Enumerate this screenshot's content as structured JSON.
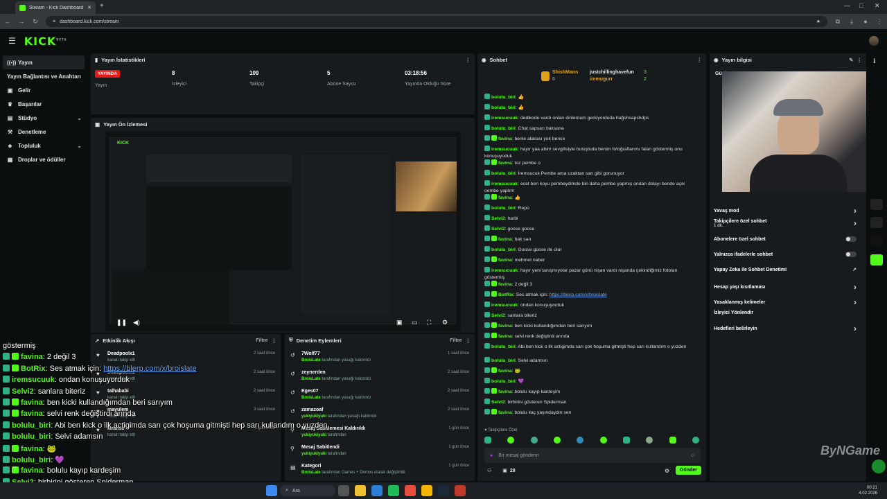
{
  "browser": {
    "tab_title": "Stream - Kick Dashboard",
    "url": "dashboard.kick.com/stream"
  },
  "header": {
    "logo": "KICK",
    "logo_sup": "BETA"
  },
  "sidebar": {
    "items": [
      {
        "label": "Yayın",
        "icon": "broadcast-icon"
      },
      {
        "label": "Yayın Bağlantısı ve Anahtarı",
        "icon": "key-icon"
      },
      {
        "label": "Gelir",
        "icon": "money-icon"
      },
      {
        "label": "Başarılar",
        "icon": "trophy-icon"
      },
      {
        "label": "Stüdyo",
        "icon": "studio-icon"
      },
      {
        "label": "Denetleme",
        "icon": "wrench-icon"
      },
      {
        "label": "Topluluk",
        "icon": "community-icon"
      },
      {
        "label": "Droplar ve ödüller",
        "icon": "gift-icon"
      }
    ]
  },
  "stats": {
    "title": "Yayın İstatistikleri",
    "live_badge": "YAYINDA",
    "live_label": "Yayın",
    "viewers": "8",
    "viewers_label": "İzleyici",
    "followers": "109",
    "followers_label": "Takipçi",
    "subs": "5",
    "subs_label": "Abone Sayısı",
    "uptime": "03:18:56",
    "uptime_label": "Yayında Olduğu Süre"
  },
  "preview": {
    "title": "Yayın Ön İzlemesi",
    "watermark": "ByNGame"
  },
  "activity": {
    "title": "Etkinlik Akışı",
    "filter": "Filtre",
    "items": [
      {
        "name": "Deadpoolx1",
        "sub": "kanalı takip etti",
        "time": "2 saat önce"
      },
      {
        "name": "Deadpoolx1",
        "sub": "kanalı takip etti",
        "time": "2 saat önce"
      },
      {
        "name": "talhababi",
        "sub": "kanalı takip etti",
        "time": "2 saat önce"
      },
      {
        "name": "mayulem",
        "sub": "kanalı takip etti",
        "time": "3 saat önce"
      },
      {
        "name": "kiraiiso",
        "sub": "kanalı takip etti",
        "time": "1 gün önce"
      }
    ]
  },
  "moderation": {
    "title": "Denetim Eylemleri",
    "filter": "Filtre",
    "items": [
      {
        "name": "7Wolf77",
        "actor": "BroisLate",
        "sub": "tarafından yasağı kaldırıldı",
        "time": "1 saat önce"
      },
      {
        "name": "zeynerden",
        "actor": "BroisLate",
        "sub": "tarafından yasağı kaldırıldı",
        "time": "2 saat önce"
      },
      {
        "name": "Eges07",
        "actor": "BroisLate",
        "sub": "tarafından yasağı kaldırıldı",
        "time": "2 saat önce"
      },
      {
        "name": "zamazoaf",
        "actor": "yukiyukiyuki",
        "sub": "tarafından yasağı kaldırıldı",
        "time": "2 saat önce"
      },
      {
        "name": "Mesaj Sabitlemesi Kaldırıldı",
        "actor": "yukiyukiyuki",
        "sub": "tarafından",
        "time": "1 gün önce"
      },
      {
        "name": "Mesaj Sabitlendi",
        "actor": "yukiyukiyuki",
        "sub": "tarafından",
        "time": "1 gün önce"
      },
      {
        "name": "Kategori",
        "actor": "BroisLate",
        "sub": "tarafından Games + Demos olarak değiştirildi",
        "time": "1 gün önce"
      }
    ]
  },
  "chat": {
    "title": "Sohbet",
    "top": [
      {
        "name": "ShishMann",
        "count": "6"
      },
      {
        "name": "justchillinghavefun",
        "count": "3"
      },
      {
        "name": "iremugurr",
        "count": "2"
      }
    ],
    "messages": [
      {
        "user": "bolulu_biri",
        "color": "#53fc18",
        "text": "👍"
      },
      {
        "user": "bolulu_biri",
        "color": "#53fc18",
        "text": "👍"
      },
      {
        "user": "iremsucuuk",
        "color": "#53fc18",
        "text": "dedikodu vardı onları dinlemem gerkiyorduda hağshsapshdps"
      },
      {
        "user": "bolulu_biri",
        "color": "#53fc18",
        "text": "Chat sapsarı baksana"
      },
      {
        "user": "favina",
        "color": "#53fc18",
        "text": "benle alakası yok bence"
      },
      {
        "user": "iremsucuuk",
        "color": "#53fc18",
        "text": "hayır yaa abim sevgilisiyle buluştuda benim fotoğraflarımı falan göstermiş onu konuşuyoduk"
      },
      {
        "user": "favina",
        "color": "#53fc18",
        "text": "toz pembe o"
      },
      {
        "user": "bolulu_biri",
        "color": "#53fc18",
        "text": "İremsucuk Pembe ama uzaktan san gibi gorunuyor"
      },
      {
        "user": "iremsucuuk",
        "color": "#53fc18",
        "text": "ecet ben koyu pembeydimde biri daha pembe yapmış ondan dolayı bende açık oembe yaptım"
      },
      {
        "user": "favina",
        "color": "#53fc18",
        "text": "👍"
      },
      {
        "user": "bolulu_biri",
        "color": "#53fc18",
        "text": "Repo"
      },
      {
        "user": "Selvi2",
        "color": "#53fc18",
        "text": "harbi"
      },
      {
        "user": "Selvi2",
        "color": "#53fc18",
        "text": "goose goose"
      },
      {
        "user": "favina",
        "color": "#53fc18",
        "text": "bak sarı"
      },
      {
        "user": "bolulu_biri",
        "color": "#53fc18",
        "text": "Goose goose de olur"
      },
      {
        "user": "favina",
        "color": "#53fc18",
        "text": "mehmet naber"
      },
      {
        "user": "iremsucuuk",
        "color": "#53fc18",
        "text": "hayır yeni tanışmıyolar pazar günü nişan vardı nişanda çekindiğimiz fotoları göstermiş"
      },
      {
        "user": "favina",
        "color": "#53fc18",
        "text": "2 değil 3"
      },
      {
        "user": "BotRix",
        "color": "#53fc18",
        "text": "Ses atmak için: ",
        "link": "https://blerp.com/x/broislate"
      },
      {
        "user": "iremsucuuk",
        "color": "#53fc18",
        "text": "ondan konuşuyorduk"
      },
      {
        "user": "Selvi2",
        "color": "#53fc18",
        "text": "sanlara biteriz"
      },
      {
        "user": "favina",
        "color": "#53fc18",
        "text": "ben kicki kullandığımdan beri sarıyım"
      },
      {
        "user": "favina",
        "color": "#53fc18",
        "text": "selvi renk değiştirdi arında"
      },
      {
        "user": "bolulu_biri",
        "color": "#53fc18",
        "text": "Abi ben kick o ilk actigimda sarı çok hoşuma gitmişti hep sarı kullandım o yuzden"
      },
      {
        "user": "bolulu_biri",
        "color": "#53fc18",
        "text": "Selvi adamsın"
      },
      {
        "user": "favina",
        "color": "#53fc18",
        "text": "🐸"
      },
      {
        "user": "bolulu_biri",
        "color": "#53fc18",
        "text": "💜"
      },
      {
        "user": "favina",
        "color": "#53fc18",
        "text": "bolulu kayıp kardeşim"
      },
      {
        "user": "Selvi2",
        "color": "#53fc18",
        "text": "birbirini gösteren Spiderman"
      },
      {
        "user": "favina",
        "color": "#53fc18",
        "text": "bolulu kaç yaşındaydın sen"
      }
    ],
    "followers_only": "Takipçilere Özel",
    "input_placeholder": "Bir mesaj gönderin",
    "viewer_count": "28",
    "send": "Gönder"
  },
  "stream_info": {
    "title": "Yayın bilgisi",
    "panel_label": "Günl",
    "rows": [
      {
        "label": "Yavaş mod",
        "end": "chevron"
      },
      {
        "label": "Takipçilere özel sohbet",
        "sub": "1 dk.",
        "end": "chevron"
      },
      {
        "label": "Abonelere özel sohbet",
        "end": "toggle"
      },
      {
        "label": "Yalnızca ifadelerle sohbet",
        "end": "toggle"
      },
      {
        "label": "Yapay Zeka ile Sohbet Denetimi",
        "end": "external"
      },
      {
        "label": "Hesap yaşı kısıtlaması",
        "end": "chevron"
      },
      {
        "label": "Yasaklanmış kelimeler",
        "end": "chevron"
      },
      {
        "label": "İzleyici Yönlendir",
        "end": ""
      },
      {
        "label": "Hedefleri belirleyin",
        "end": "chevron"
      }
    ]
  },
  "overlay_chat": [
    {
      "user": "",
      "text": "göstermiş"
    },
    {
      "user": "favina",
      "text": ": 2 değil 3"
    },
    {
      "user": "BotRix",
      "text": ": Ses atmak için: ",
      "link": "https://blerp.com/x/broislate"
    },
    {
      "user": "iremsucuuk",
      "text": ": ondan konuşuyorduk"
    },
    {
      "user": "Selvi2",
      "text": ": sanlara biteriz"
    },
    {
      "user": "favina",
      "text": ": ben kicki kullandığımdan beri sarıyım"
    },
    {
      "user": "favina",
      "text": ": selvi renk değiştirdi arında"
    },
    {
      "user": "bolulu_biri",
      "text": ": Abi ben kick o ilk actigimda sarı çok hoşuma gitmişti hep sarı kullandım o yuzden"
    },
    {
      "user": "bolulu_biri",
      "text": ": Selvi adamsın"
    },
    {
      "user": "favina",
      "text": ": 🐸"
    },
    {
      "user": "bolulu_biri",
      "text": ": 💜"
    },
    {
      "user": "favina",
      "text": ": bolulu kayıp kardeşim"
    },
    {
      "user": "Selvi2",
      "text": ": birbirini gösteren Spiderman"
    },
    {
      "user": "favina",
      "text": ": bolulu kaç yaşındaydın sen"
    }
  ],
  "taskbar": {
    "search": "Ara",
    "time": "00:21",
    "date": "4.02.2026"
  },
  "colors": {
    "kick_green": "#53fc18",
    "live_red": "#e91916",
    "panel": "#181b1d",
    "bg": "#0b0e0f"
  }
}
